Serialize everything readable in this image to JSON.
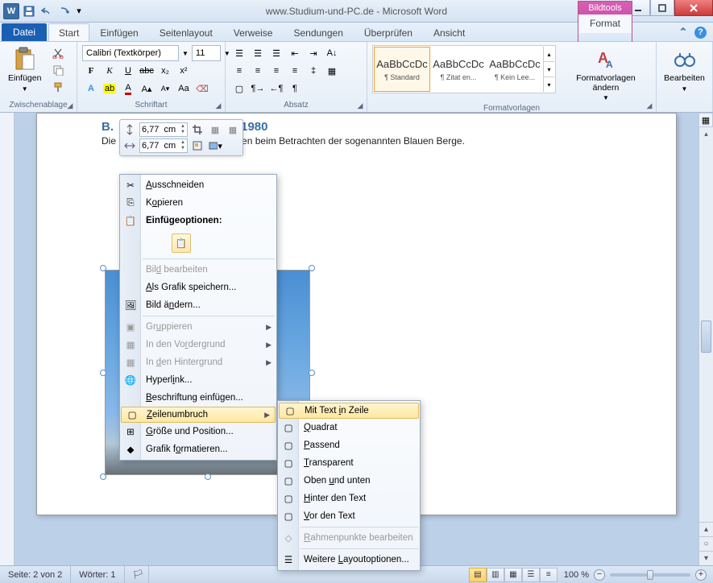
{
  "title": "www.Studium-und-PC.de  -  Microsoft Word",
  "context_group_label": "Bildtools",
  "tabs": {
    "file": "Datei",
    "items": [
      "Start",
      "Einfügen",
      "Seitenlayout",
      "Verweise",
      "Sendungen",
      "Überprüfen",
      "Ansicht"
    ],
    "context_tab": "Format",
    "active_index": 0
  },
  "ribbon": {
    "clipboard": {
      "label": "Zwischenablage",
      "paste": "Einfügen"
    },
    "font": {
      "label": "Schriftart",
      "name": "Calibri (Textkörper)",
      "size": "11"
    },
    "paragraph": {
      "label": "Absatz"
    },
    "styles": {
      "label": "Formatvorlagen",
      "items": [
        {
          "preview": "AaBbCcDc",
          "name": "¶ Standard"
        },
        {
          "preview": "AaBbCcDc",
          "name": "¶ Zitat en..."
        },
        {
          "preview": "AaBbCcDc",
          "name": "¶ Kein Lee..."
        }
      ],
      "change": "Formatvorlagen ändern"
    },
    "editing": {
      "label": "Bearbeiten",
      "find": "Bearbeiten"
    }
  },
  "document": {
    "heading_left": "B.",
    "heading_right": "1980",
    "body": "Die",
    "body_right": "nden beim Betrachten der sogenannten Blauen Berge."
  },
  "mini_toolbar": {
    "height": "6,77  cm",
    "width": "6,77  cm"
  },
  "context_menu": {
    "cut": "Ausschneiden",
    "copy": "Kopieren",
    "paste_options": "Einfügeoptionen:",
    "edit_picture": "Bild bearbeiten",
    "save_as_picture": "Als Grafik speichern...",
    "change_picture": "Bild ändern...",
    "group": "Gruppieren",
    "bring_front": "In den Vordergrund",
    "send_back": "In den Hintergrund",
    "hyperlink": "Hyperlink...",
    "caption": "Beschriftung einfügen...",
    "wrap": "Zeilenumbruch",
    "size_pos": "Größe und Position...",
    "format": "Grafik formatieren..."
  },
  "wrap_submenu": {
    "inline": "Mit Text in Zeile",
    "square": "Quadrat",
    "tight": "Passend",
    "through": "Transparent",
    "topbottom": "Oben und unten",
    "behind": "Hinter den Text",
    "infront": "Vor den Text",
    "edit_points": "Rahmenpunkte bearbeiten",
    "more": "Weitere Layoutoptionen..."
  },
  "statusbar": {
    "page": "Seite: 2 von 2",
    "words": "Wörter: 1",
    "zoom": "100 %"
  }
}
